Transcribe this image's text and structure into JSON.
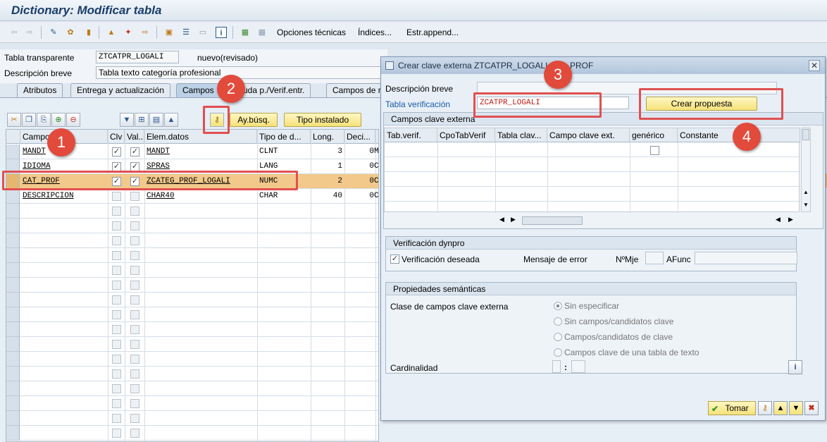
{
  "window": {
    "title": "Dictionary: Modificar tabla"
  },
  "toolbar": {
    "icons": [
      "back-icon",
      "forward-icon",
      "other-object-icon",
      "display-change-icon",
      "activate-icon",
      "check-icon",
      "test-icon",
      "where-used-icon",
      "object-list-icon",
      "navigate-icon",
      "display-icon",
      "info-icon",
      "columns-icon",
      "layout-icon"
    ],
    "technical_options": "Opciones técnicas",
    "indices": "Índices...",
    "append_structure": "Estr.append..."
  },
  "header": {
    "table_type_label": "Tabla transparente",
    "table_name": "ZTCATPR_LOGALI",
    "status": "nuevo(revisado)",
    "short_desc_label": "Descripción breve",
    "short_desc": "Tabla texto categoría profesional"
  },
  "tabs": [
    {
      "label": "Atributos"
    },
    {
      "label": "Entrega y actualización"
    },
    {
      "label": "Campos"
    },
    {
      "label": "uda p./Verif.entr."
    },
    {
      "label": "Campos de r"
    }
  ],
  "fields_toolbar": {
    "search_help": "Ay.búsq.",
    "builtin_type": "Tipo instalado"
  },
  "grid": {
    "columns": [
      "Campo",
      "Clv",
      "Val...",
      "Elem.datos",
      "Tipo de d...",
      "Long.",
      "Deci...",
      "..."
    ],
    "rows": [
      {
        "field": "MANDT",
        "key": true,
        "initial": true,
        "data_element": "MANDT",
        "type": "CLNT",
        "length": "3",
        "decimals": "0",
        "extra": "M"
      },
      {
        "field": "IDIOMA",
        "key": true,
        "initial": true,
        "data_element": "SPRAS",
        "type": "LANG",
        "length": "1",
        "decimals": "0",
        "extra": "C"
      },
      {
        "field": "CAT_PROF",
        "key": true,
        "initial": true,
        "data_element": "ZCATEG_PROF_LOGALI",
        "type": "NUMC",
        "length": "2",
        "decimals": "0",
        "extra": "C"
      },
      {
        "field": "DESCRIPCION",
        "key": false,
        "initial": false,
        "data_element": "CHAR40",
        "type": "CHAR",
        "length": "40",
        "decimals": "0",
        "extra": "C"
      }
    ]
  },
  "dialog": {
    "title": "Crear clave externa ZTCATPR_LOGALI",
    "title_tail": "PROF",
    "short_desc_label": "Descripción breve",
    "check_table_label": "Tabla verificación",
    "check_table_value": "ZCATPR_LOGALI",
    "create_proposal": "Crear propuesta",
    "fk_fields_group": "Campos clave externa",
    "fk_columns": [
      "Tab.verif.",
      "CpoTabVerif",
      "Tabla clav...",
      "Campo clave ext.",
      "genérico",
      "Constante"
    ],
    "dynpro_group": "Verificación dynpro",
    "check_required": "Verificación deseada",
    "error_message_label": "Mensaje de error",
    "msg_no_label": "NºMje",
    "afunc_label": "AFunc",
    "semantic_group": "Propiedades semánticas",
    "fk_field_class_label": "Clase de campos clave externa",
    "radios": [
      "Sin especificar",
      "Sin campos/candidatos clave",
      "Campos/candidatos de clave",
      "Campos clave de una tabla de texto"
    ],
    "cardinality_label": "Cardinalidad",
    "cardinality_sep": ":",
    "ok_button": "Tomar"
  },
  "annotations": [
    "1",
    "2",
    "3",
    "4"
  ],
  "colors": {
    "highlight_row": "#f2c98a",
    "annotation": "#e24a3b",
    "check_table_text": "#c01818"
  }
}
